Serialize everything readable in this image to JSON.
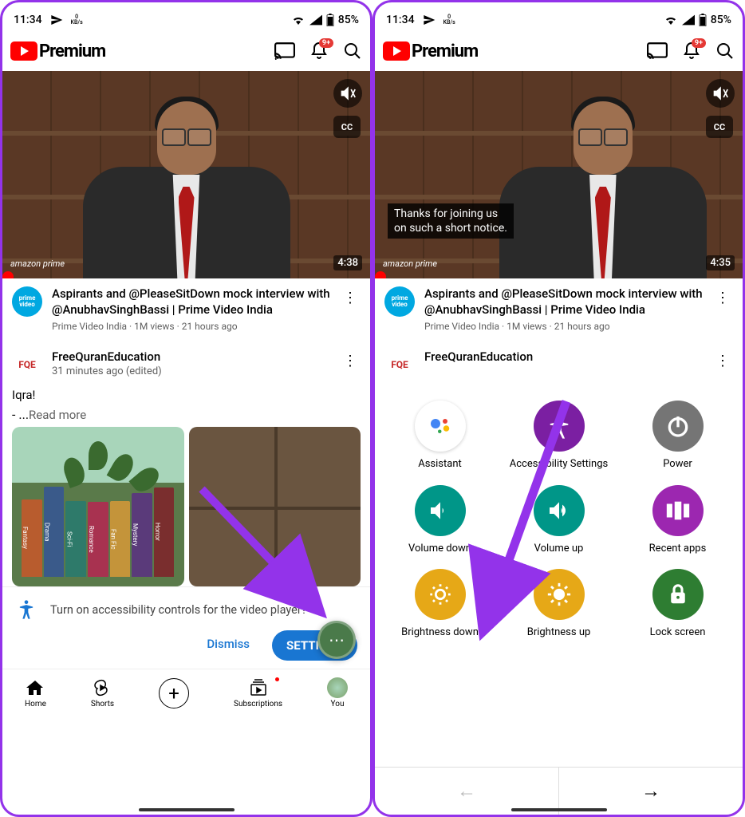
{
  "status": {
    "time": "11:34",
    "kbps_num": "0",
    "kbps_unit": "KB/s",
    "battery": "85%"
  },
  "header": {
    "brand": "Premium",
    "badge": "9+"
  },
  "video": {
    "duration_left": "4:38",
    "duration_right": "4:35",
    "prime": "amazon prime",
    "cc": "CC",
    "caption_line1": "Thanks for joining us",
    "caption_line2": "on such a short notice.",
    "title": "Aspirants and @PleaseSitDown mock interview with @AnubhavSinghBassi | Prime Video India",
    "channel": "Prime Video India",
    "meta": "Prime Video India · 1M views · 21 hours ago",
    "avatar_text": "prime video"
  },
  "post": {
    "channel": "FreeQuranEducation",
    "time": "31 minutes ago (edited)",
    "avatar": "FQE",
    "text": "Iqra!",
    "more_prefix": "-  ...",
    "more": "Read more",
    "books": [
      "Fantasy",
      "Drama",
      "Sci-Fi",
      "Romance",
      "Fan Fic",
      "Mystery",
      "Horror"
    ]
  },
  "prompt": {
    "text": "Turn on accessibility controls for the video player?",
    "dismiss": "Dismiss",
    "settings": "SETTINGS"
  },
  "nav": {
    "home": "Home",
    "shorts": "Shorts",
    "subs": "Subscriptions",
    "you": "You"
  },
  "menu": {
    "items": [
      {
        "label": "Assistant",
        "bg": "#ffffff",
        "border": true
      },
      {
        "label": "Accessibility Settings",
        "bg": "#7b1fa2"
      },
      {
        "label": "Power",
        "bg": "#757575"
      },
      {
        "label": "Volume down",
        "bg": "#009688"
      },
      {
        "label": "Volume up",
        "bg": "#009688"
      },
      {
        "label": "Recent apps",
        "bg": "#9c27b0"
      },
      {
        "label": "Brightness down",
        "bg": "#e6a817"
      },
      {
        "label": "Brightness up",
        "bg": "#e6a817"
      },
      {
        "label": "Lock screen",
        "bg": "#2e7d32"
      }
    ]
  }
}
